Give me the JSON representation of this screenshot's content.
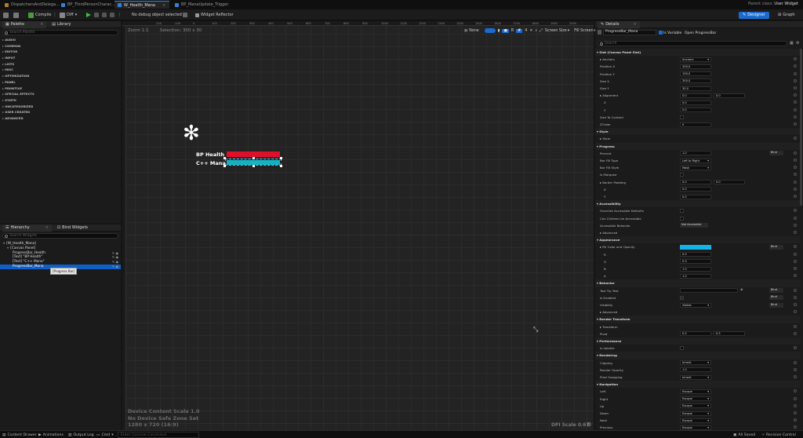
{
  "tabs": [
    {
      "label": "DispatchersAndDelega...",
      "active": false
    },
    {
      "label": "BP_ThirdPersonCharac...",
      "active": false
    },
    {
      "label": "W_Health_Mana",
      "active": true
    },
    {
      "label": "BP_ManaUpdate_Trigger",
      "active": false
    }
  ],
  "window": {
    "parent_class_label": "Parent class:",
    "parent_class_value": "User Widget"
  },
  "toolbar": {
    "compile_label": "Compile",
    "diff_label": "Diff",
    "debug_dropdown": "No debug object selected",
    "reflector_label": "Widget Reflector",
    "designer_label": "Designer",
    "graph_label": "Graph"
  },
  "palette": {
    "tab_label": "Palette",
    "library_label": "Library",
    "search_placeholder": "Search Palette",
    "categories": [
      "AUDIO",
      "COMMON",
      "EDITOR",
      "INPUT",
      "LISTS",
      "MISC",
      "OPTIMIZATION",
      "PANEL",
      "PRIMITIVE",
      "SPECIAL EFFECTS",
      "SYNTH",
      "UNCATEGORIZED",
      "USER CREATED",
      "ADVANCED"
    ]
  },
  "hierarchy": {
    "tab_label": "Hierarchy",
    "bind_label": "Bind Widgets",
    "search_placeholder": "Search Widgets",
    "items": [
      {
        "label": "[W_Health_Mana]",
        "indent": 0
      },
      {
        "label": "[Canvas Panel]",
        "indent": 1
      },
      {
        "label": "ProgressBar_Health",
        "indent": 2
      },
      {
        "label": "[Text] \"BP Health\"",
        "indent": 2
      },
      {
        "label": "[Text] \"C++ Mana\"",
        "indent": 2
      },
      {
        "label": "ProgressBar_Mana",
        "indent": 2,
        "selected": true
      }
    ],
    "tooltip": "[Progress Bar]"
  },
  "canvas": {
    "zoom": "Zoom 1:1",
    "selection": "Selection: 300 x 30",
    "ruler_ticks": [
      "-200",
      "-100",
      "0",
      "100",
      "200",
      "300",
      "400",
      "500",
      "600",
      "700",
      "800",
      "900",
      "1000",
      "1100",
      "1200",
      "1300",
      "1400",
      "1500",
      "1600",
      "1700",
      "1800",
      "1900",
      "2000"
    ],
    "none_label": "None",
    "r_label": "R",
    "grid_value": "4",
    "screen_size": "Screen Size",
    "fill_screen": "Fill Screen",
    "health_label": "BP Health",
    "mana_label": "C++ Mana",
    "health_color": "#e0102a",
    "mana_color": "#12b4c2",
    "info_lines": [
      "Device Content Scale 1.0",
      "No Device Safe Zone Set",
      "1280 x 720 (16:9)"
    ],
    "dpi": "DPI Scale 0.67"
  },
  "details": {
    "tab_label": "Details",
    "widget_name": "ProgressBar_Mana",
    "is_variable": "Is Variable",
    "open_label": "Open ProgressBar",
    "search_placeholder": "Search",
    "rows": [
      {
        "kind": "sec",
        "label": "Slot (Canvas Panel Slot)"
      },
      {
        "kind": "row",
        "label": "Anchors",
        "dropdown": "Anchors"
      },
      {
        "kind": "row",
        "label": "Position X",
        "value": "200.0",
        "bind": false
      },
      {
        "kind": "row",
        "label": "Position Y",
        "value": "190.0"
      },
      {
        "kind": "row",
        "label": "Size X",
        "value": "300.0"
      },
      {
        "kind": "row",
        "label": "Size Y",
        "value": "30.0"
      },
      {
        "kind": "row",
        "label": "Alignment",
        "value": "0.0",
        "value2": "0.0"
      },
      {
        "kind": "sub",
        "label": "X",
        "value": "0.0"
      },
      {
        "kind": "sub",
        "label": "Y",
        "value": "0.0"
      },
      {
        "kind": "row",
        "label": "Size To Content",
        "check": true
      },
      {
        "kind": "row",
        "label": "ZOrder",
        "value": "0"
      },
      {
        "kind": "sec",
        "label": "Style"
      },
      {
        "kind": "row",
        "label": "Style"
      },
      {
        "kind": "sec",
        "label": "Progress"
      },
      {
        "kind": "row",
        "label": "Percent",
        "value": "1.0",
        "bind": "Bind"
      },
      {
        "kind": "row",
        "label": "Bar Fill Type",
        "dropdown": "Left to Right"
      },
      {
        "kind": "row",
        "label": "Bar Fill Style",
        "dropdown": "Mask"
      },
      {
        "kind": "row",
        "label": "Is Marquee",
        "check": true
      },
      {
        "kind": "row",
        "label": "Border Padding",
        "value": "0.0",
        "value2": "0.0"
      },
      {
        "kind": "sub",
        "label": "X",
        "value": "0.0"
      },
      {
        "kind": "sub",
        "label": "Y",
        "value": "0.0"
      },
      {
        "kind": "sec",
        "label": "Accessibility"
      },
      {
        "kind": "row",
        "label": "Override Accessible Defaults",
        "check": true
      },
      {
        "kind": "row",
        "label": "Can Children be Accessible",
        "check": true
      },
      {
        "kind": "row",
        "label": "Accessible Behavior",
        "bindlong": "Not Accessible"
      },
      {
        "kind": "row",
        "label": "Advanced"
      },
      {
        "kind": "sec",
        "label": "Appearance"
      },
      {
        "kind": "row",
        "label": "Fill Color and Opacity",
        "color": "#12b4e8",
        "bind": "Bind"
      },
      {
        "kind": "sub",
        "label": "R",
        "value": "0.0"
      },
      {
        "kind": "sub",
        "label": "G",
        "value": "0.3"
      },
      {
        "kind": "sub",
        "label": "B",
        "value": "1.0"
      },
      {
        "kind": "sub",
        "label": "A",
        "value": "1.0"
      },
      {
        "kind": "sec",
        "label": "Behavior"
      },
      {
        "kind": "row",
        "label": "Tool Tip Text",
        "wide": true,
        "bind": "Bind"
      },
      {
        "kind": "row",
        "label": "Is Enabled",
        "check": true,
        "checked": true,
        "bind": "Bind"
      },
      {
        "kind": "row",
        "label": "Visibility",
        "dropdown": "Visible",
        "bind": "Bind"
      },
      {
        "kind": "row",
        "label": "Advanced"
      },
      {
        "kind": "sec",
        "label": "Render Transform"
      },
      {
        "kind": "row",
        "label": "Transform"
      },
      {
        "kind": "row",
        "label": "Pivot",
        "value": "0.5",
        "value2": "0.5"
      },
      {
        "kind": "sec",
        "label": "Performance"
      },
      {
        "kind": "row",
        "label": "Is Volatile",
        "check": true
      },
      {
        "kind": "sec",
        "label": "Rendering"
      },
      {
        "kind": "row",
        "label": "Clipping",
        "dropdown": "Inherit"
      },
      {
        "kind": "row",
        "label": "Render Opacity",
        "value": "1.0"
      },
      {
        "kind": "row",
        "label": "Pixel Snapping",
        "dropdown": "Inherit"
      },
      {
        "kind": "sec",
        "label": "Navigation"
      },
      {
        "kind": "row",
        "label": "Left",
        "dropdown": "Escape"
      },
      {
        "kind": "row",
        "label": "Right",
        "dropdown": "Escape"
      },
      {
        "kind": "row",
        "label": "Up",
        "dropdown": "Escape"
      },
      {
        "kind": "row",
        "label": "Down",
        "dropdown": "Escape"
      },
      {
        "kind": "row",
        "label": "Next",
        "dropdown": "Escape"
      },
      {
        "kind": "row",
        "label": "Previous",
        "dropdown": "Escape"
      }
    ]
  },
  "statusbar": {
    "content_drawer": "Content Drawer",
    "animations": "Animations",
    "output_log": "Output Log",
    "cmd": "Cmd",
    "console_placeholder": "Enter Console Command",
    "all_saved": "All Saved",
    "revision_control": "Revision Control"
  }
}
